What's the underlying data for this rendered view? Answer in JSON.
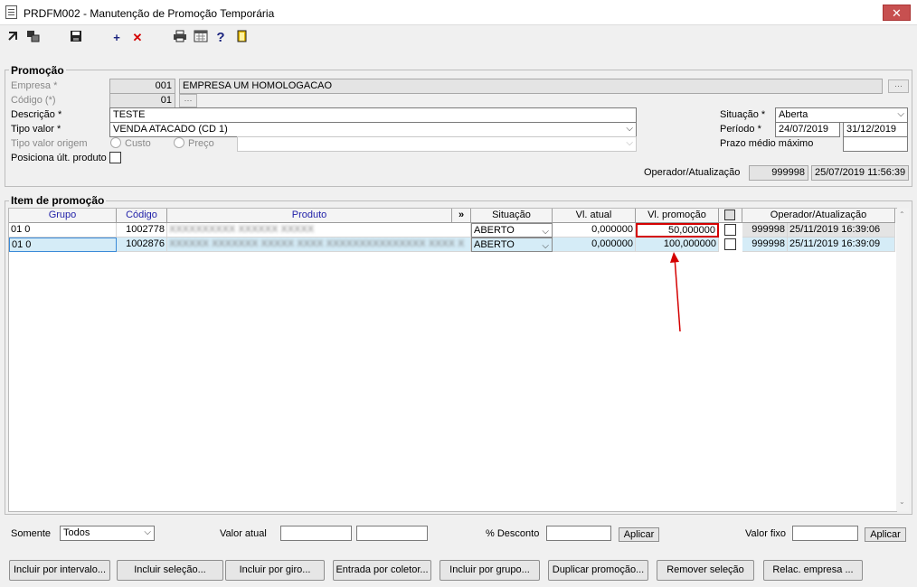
{
  "window": {
    "title": "PRDFM002 - Manutenção de Promoção Temporária",
    "close": "✕"
  },
  "toolbar": {
    "add": "+",
    "delete": "✕",
    "help": "?"
  },
  "promocao": {
    "legend": "Promoção",
    "empresa_label": "Empresa *",
    "empresa_code": "001",
    "empresa_name": "EMPRESA UM  HOMOLOGACAO",
    "codigo_label": "Código (*)",
    "codigo_value": "01",
    "descricao_label": "Descrição *",
    "descricao_value": "TESTE",
    "tipo_valor_label": "Tipo valor *",
    "tipo_valor_value": "VENDA ATACADO (CD 1)",
    "tipo_valor_origem_label": "Tipo valor origem",
    "radio_custo": "Custo",
    "radio_preco": "Preço",
    "posiciona_label": "Posiciona últ. produto",
    "situacao_label": "Situação *",
    "situacao_value": "Aberta",
    "periodo_label": "Período *",
    "periodo_start": "24/07/2019",
    "periodo_end": "31/12/2019",
    "prazo_label": "Prazo médio máximo",
    "operador_label": "Operador/Atualização",
    "operador_value": "999998",
    "operador_date": "25/07/2019 11:56:39"
  },
  "items": {
    "legend": "Item de promoção",
    "columns": {
      "grupo": "Grupo",
      "codigo": "Código",
      "produto": "Produto",
      "expand": "»",
      "situacao": "Situação",
      "vl_atual": "Vl. atual",
      "vl_promocao": "Vl. promoção",
      "operador": "Operador/Atualização"
    },
    "rows": [
      {
        "grupo": "01 0",
        "codigo": "1002778",
        "produto": "XXXXXXXXXX XXXXXX XXXXX",
        "situacao": "ABERTO",
        "vl_atual": "0,000000",
        "vl_promocao": "50,000000",
        "operador": "999998",
        "data": "25/11/2019 16:39:06"
      },
      {
        "grupo": "01 0",
        "codigo": "1002876",
        "produto": "XXXXXX XXXXXXX XXXXX XXXX XXXXXXXXXXXXXXX XXXX X",
        "situacao": "ABERTO",
        "vl_atual": "0,000000",
        "vl_promocao": "100,000000",
        "operador": "999998",
        "data": "25/11/2019 16:39:09"
      }
    ]
  },
  "filters": {
    "somente_label": "Somente",
    "somente_value": "Todos",
    "valor_atual_label": "Valor atual",
    "desconto_label": "% Desconto",
    "aplicar": "Aplicar",
    "valor_fixo_label": "Valor fixo"
  },
  "buttons": {
    "incluir_intervalo": "Incluir por intervalo...",
    "incluir_selecao": "Incluir seleção...",
    "incluir_giro": "Incluir por giro...",
    "entrada_coletor": "Entrada por coletor...",
    "incluir_grupo": "Incluir por grupo...",
    "duplicar": "Duplicar promoção...",
    "remover": "Remover seleção",
    "relac_empresa": "Relac. empresa ..."
  },
  "colors": {
    "highlight": "#d40000",
    "arrow": "#d40000",
    "header_blue": "#1f1fa8",
    "row_selected": "#d5ecf7"
  }
}
